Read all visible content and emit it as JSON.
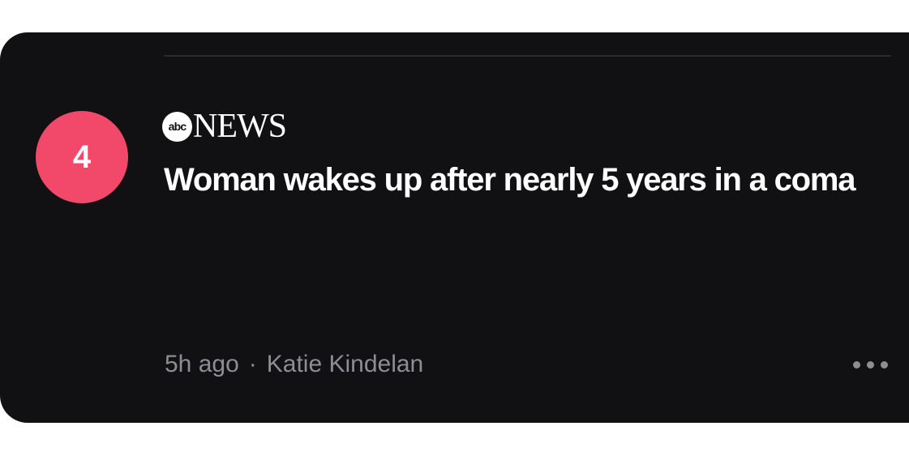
{
  "story": {
    "rank": "4",
    "publisher": {
      "logo_text": "abc",
      "name": "NEWS"
    },
    "headline": "Woman wakes up after nearly 5 years in a coma",
    "time_ago": "5h ago",
    "separator": "·",
    "author": "Katie Kindelan",
    "more_icon": "more-horizontal-icon"
  },
  "colors": {
    "card_background": "#111012",
    "rank_badge": "#f2496a",
    "meta_text": "#8e8d93"
  }
}
